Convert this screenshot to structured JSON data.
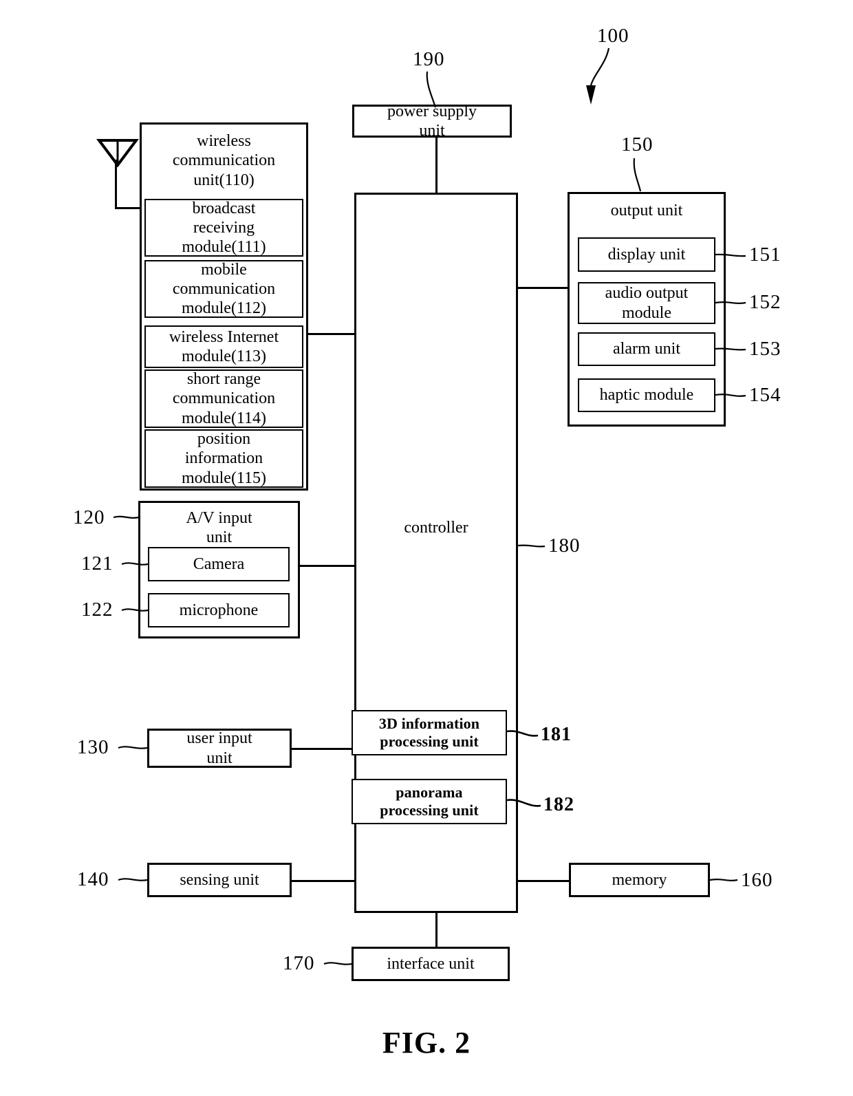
{
  "figure": {
    "caption": "FIG. 2",
    "system_ref": "100"
  },
  "blocks": {
    "power_supply": {
      "label": "power supply\nunit",
      "ref": "190"
    },
    "wireless_unit": {
      "label": "wireless\ncommunication\nunit(110)",
      "ref": "110"
    },
    "broadcast_receiving": {
      "label": "broadcast\nreceiving\nmodule(111)",
      "ref": "111"
    },
    "mobile_communication": {
      "label": "mobile\ncommunication\nmodule(112)",
      "ref": "112"
    },
    "wireless_internet": {
      "label": "wireless  Internet\nmodule(113)",
      "ref": "113"
    },
    "short_range": {
      "label": "short range\ncommunication\nmodule(114)",
      "ref": "114"
    },
    "position_information": {
      "label": "position\ninformation\nmodule(115)",
      "ref": "115"
    },
    "av_input": {
      "label": "A/V input\nunit",
      "ref": "120"
    },
    "camera": {
      "label": "Camera",
      "ref": "121"
    },
    "microphone": {
      "label": "microphone",
      "ref": "122"
    },
    "user_input": {
      "label": "user input\nunit",
      "ref": "130"
    },
    "sensing": {
      "label": "sensing unit",
      "ref": "140"
    },
    "controller": {
      "label": "controller",
      "ref": "180"
    },
    "three_d_processing": {
      "label": "3D information\nprocessing unit",
      "ref": "181"
    },
    "panorama_processing": {
      "label": "panorama\nprocessing unit",
      "ref": "182"
    },
    "output_unit": {
      "label": "output unit",
      "ref": "150"
    },
    "display_unit": {
      "label": "display unit",
      "ref": "151"
    },
    "audio_output": {
      "label": "audio output\nmodule",
      "ref": "152"
    },
    "alarm_unit": {
      "label": "alarm  unit",
      "ref": "153"
    },
    "haptic_module": {
      "label": "haptic module",
      "ref": "154"
    },
    "memory": {
      "label": "memory",
      "ref": "160"
    },
    "interface": {
      "label": "interface  unit",
      "ref": "170"
    }
  },
  "icons": {
    "antenna": "antenna-icon",
    "system_arrow": "arrow-icon"
  },
  "colors": {
    "stroke": "#000000",
    "background": "#ffffff"
  }
}
